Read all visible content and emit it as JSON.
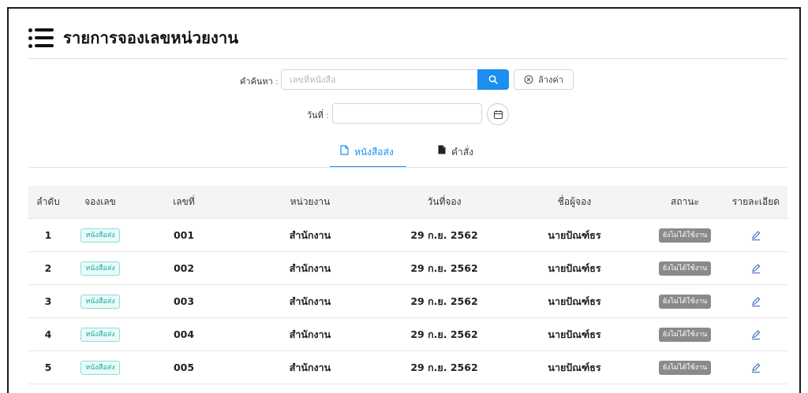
{
  "header": {
    "title": "รายการจองเลขหน่วยงาน",
    "icon": "list-icon"
  },
  "search": {
    "keyword_label": "คำค้นหา",
    "keyword_colon": ":",
    "keyword_placeholder": "เลขที่หนังสือ",
    "keyword_value": "",
    "search_icon": "search-icon",
    "clear_label": "ล้างค่า",
    "clear_icon": "clear-circle-icon",
    "date_label": "วันที่",
    "date_colon": ":",
    "date_value": "",
    "calendar_icon": "calendar-icon"
  },
  "tabs": [
    {
      "label": "หนังสือส่ง",
      "icon": "document-outline-icon",
      "active": true
    },
    {
      "label": "คำสั่ง",
      "icon": "document-filled-icon",
      "active": false
    }
  ],
  "table": {
    "columns": [
      "ลำดับ",
      "จองเลข",
      "เลขที่",
      "หน่วยงาน",
      "วันที่จอง",
      "ชื่อผู้จอง",
      "สถานะ",
      "รายละเอียด"
    ],
    "rows": [
      {
        "no": "1",
        "type": "หนังสือส่ง",
        "number": "001",
        "unit": "สำนักงาน",
        "date": "29 ก.ย. 2562",
        "booker": "นายปัณฑ์ธร",
        "status": "ยังไม่ได้ใช้งาน"
      },
      {
        "no": "2",
        "type": "หนังสือส่ง",
        "number": "002",
        "unit": "สำนักงาน",
        "date": "29 ก.ย. 2562",
        "booker": "นายปัณฑ์ธร",
        "status": "ยังไม่ได้ใช้งาน"
      },
      {
        "no": "3",
        "type": "หนังสือส่ง",
        "number": "003",
        "unit": "สำนักงาน",
        "date": "29 ก.ย. 2562",
        "booker": "นายปัณฑ์ธร",
        "status": "ยังไม่ได้ใช้งาน"
      },
      {
        "no": "4",
        "type": "หนังสือส่ง",
        "number": "004",
        "unit": "สำนักงาน",
        "date": "29 ก.ย. 2562",
        "booker": "นายปัณฑ์ธร",
        "status": "ยังไม่ได้ใช้งาน"
      },
      {
        "no": "5",
        "type": "หนังสือส่ง",
        "number": "005",
        "unit": "สำนักงาน",
        "date": "29 ก.ย. 2562",
        "booker": "นายปัณฑ์ธร",
        "status": "ยังไม่ได้ใช้งาน"
      }
    ]
  },
  "colors": {
    "accent": "#1c8ff0",
    "type_badge": "#17a8a0",
    "status_badge": "#8a8a8a",
    "edit_icon": "#3b63c4"
  }
}
